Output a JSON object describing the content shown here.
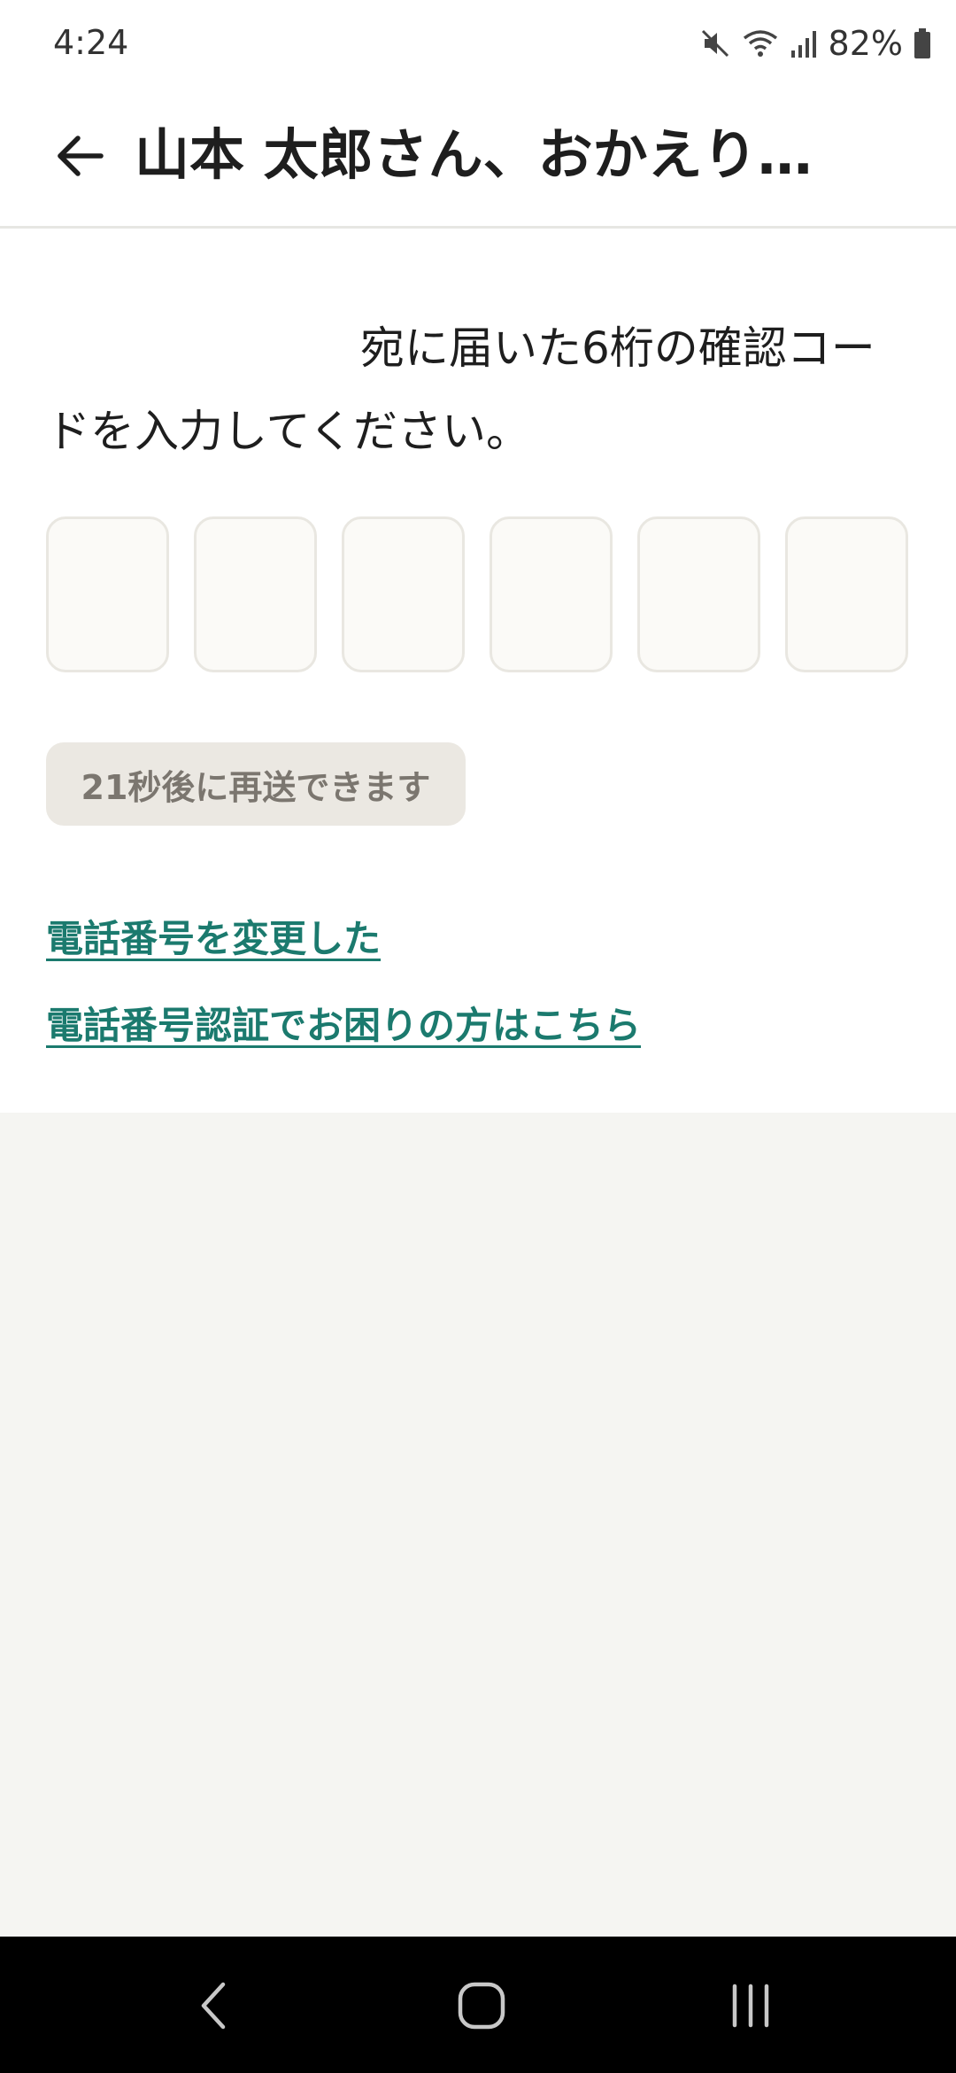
{
  "status_bar": {
    "time": "4:24",
    "battery": "82%",
    "icons": [
      "mute-icon",
      "wifi-icon",
      "signal-icon",
      "battery-icon"
    ]
  },
  "header": {
    "back_icon": "arrow-left-icon",
    "title": "山本 太郎さん、おかえり…"
  },
  "main": {
    "instruction_text": "宛に届いた6桁の確認コードを入力してください。",
    "code_length": 6,
    "resend_label": "21秒後に再送できます",
    "links": {
      "change_phone": "電話番号を変更した",
      "help": "電話番号認証でお困りの方はこちら"
    }
  },
  "colors": {
    "link": "#1b7a6e",
    "resend_bg": "#ebe8e2",
    "resend_text": "#7b766f",
    "page_bg": "#f5f5f2"
  },
  "nav_bar": {
    "icons": [
      "nav-back-icon",
      "nav-home-icon",
      "nav-recents-icon"
    ]
  }
}
